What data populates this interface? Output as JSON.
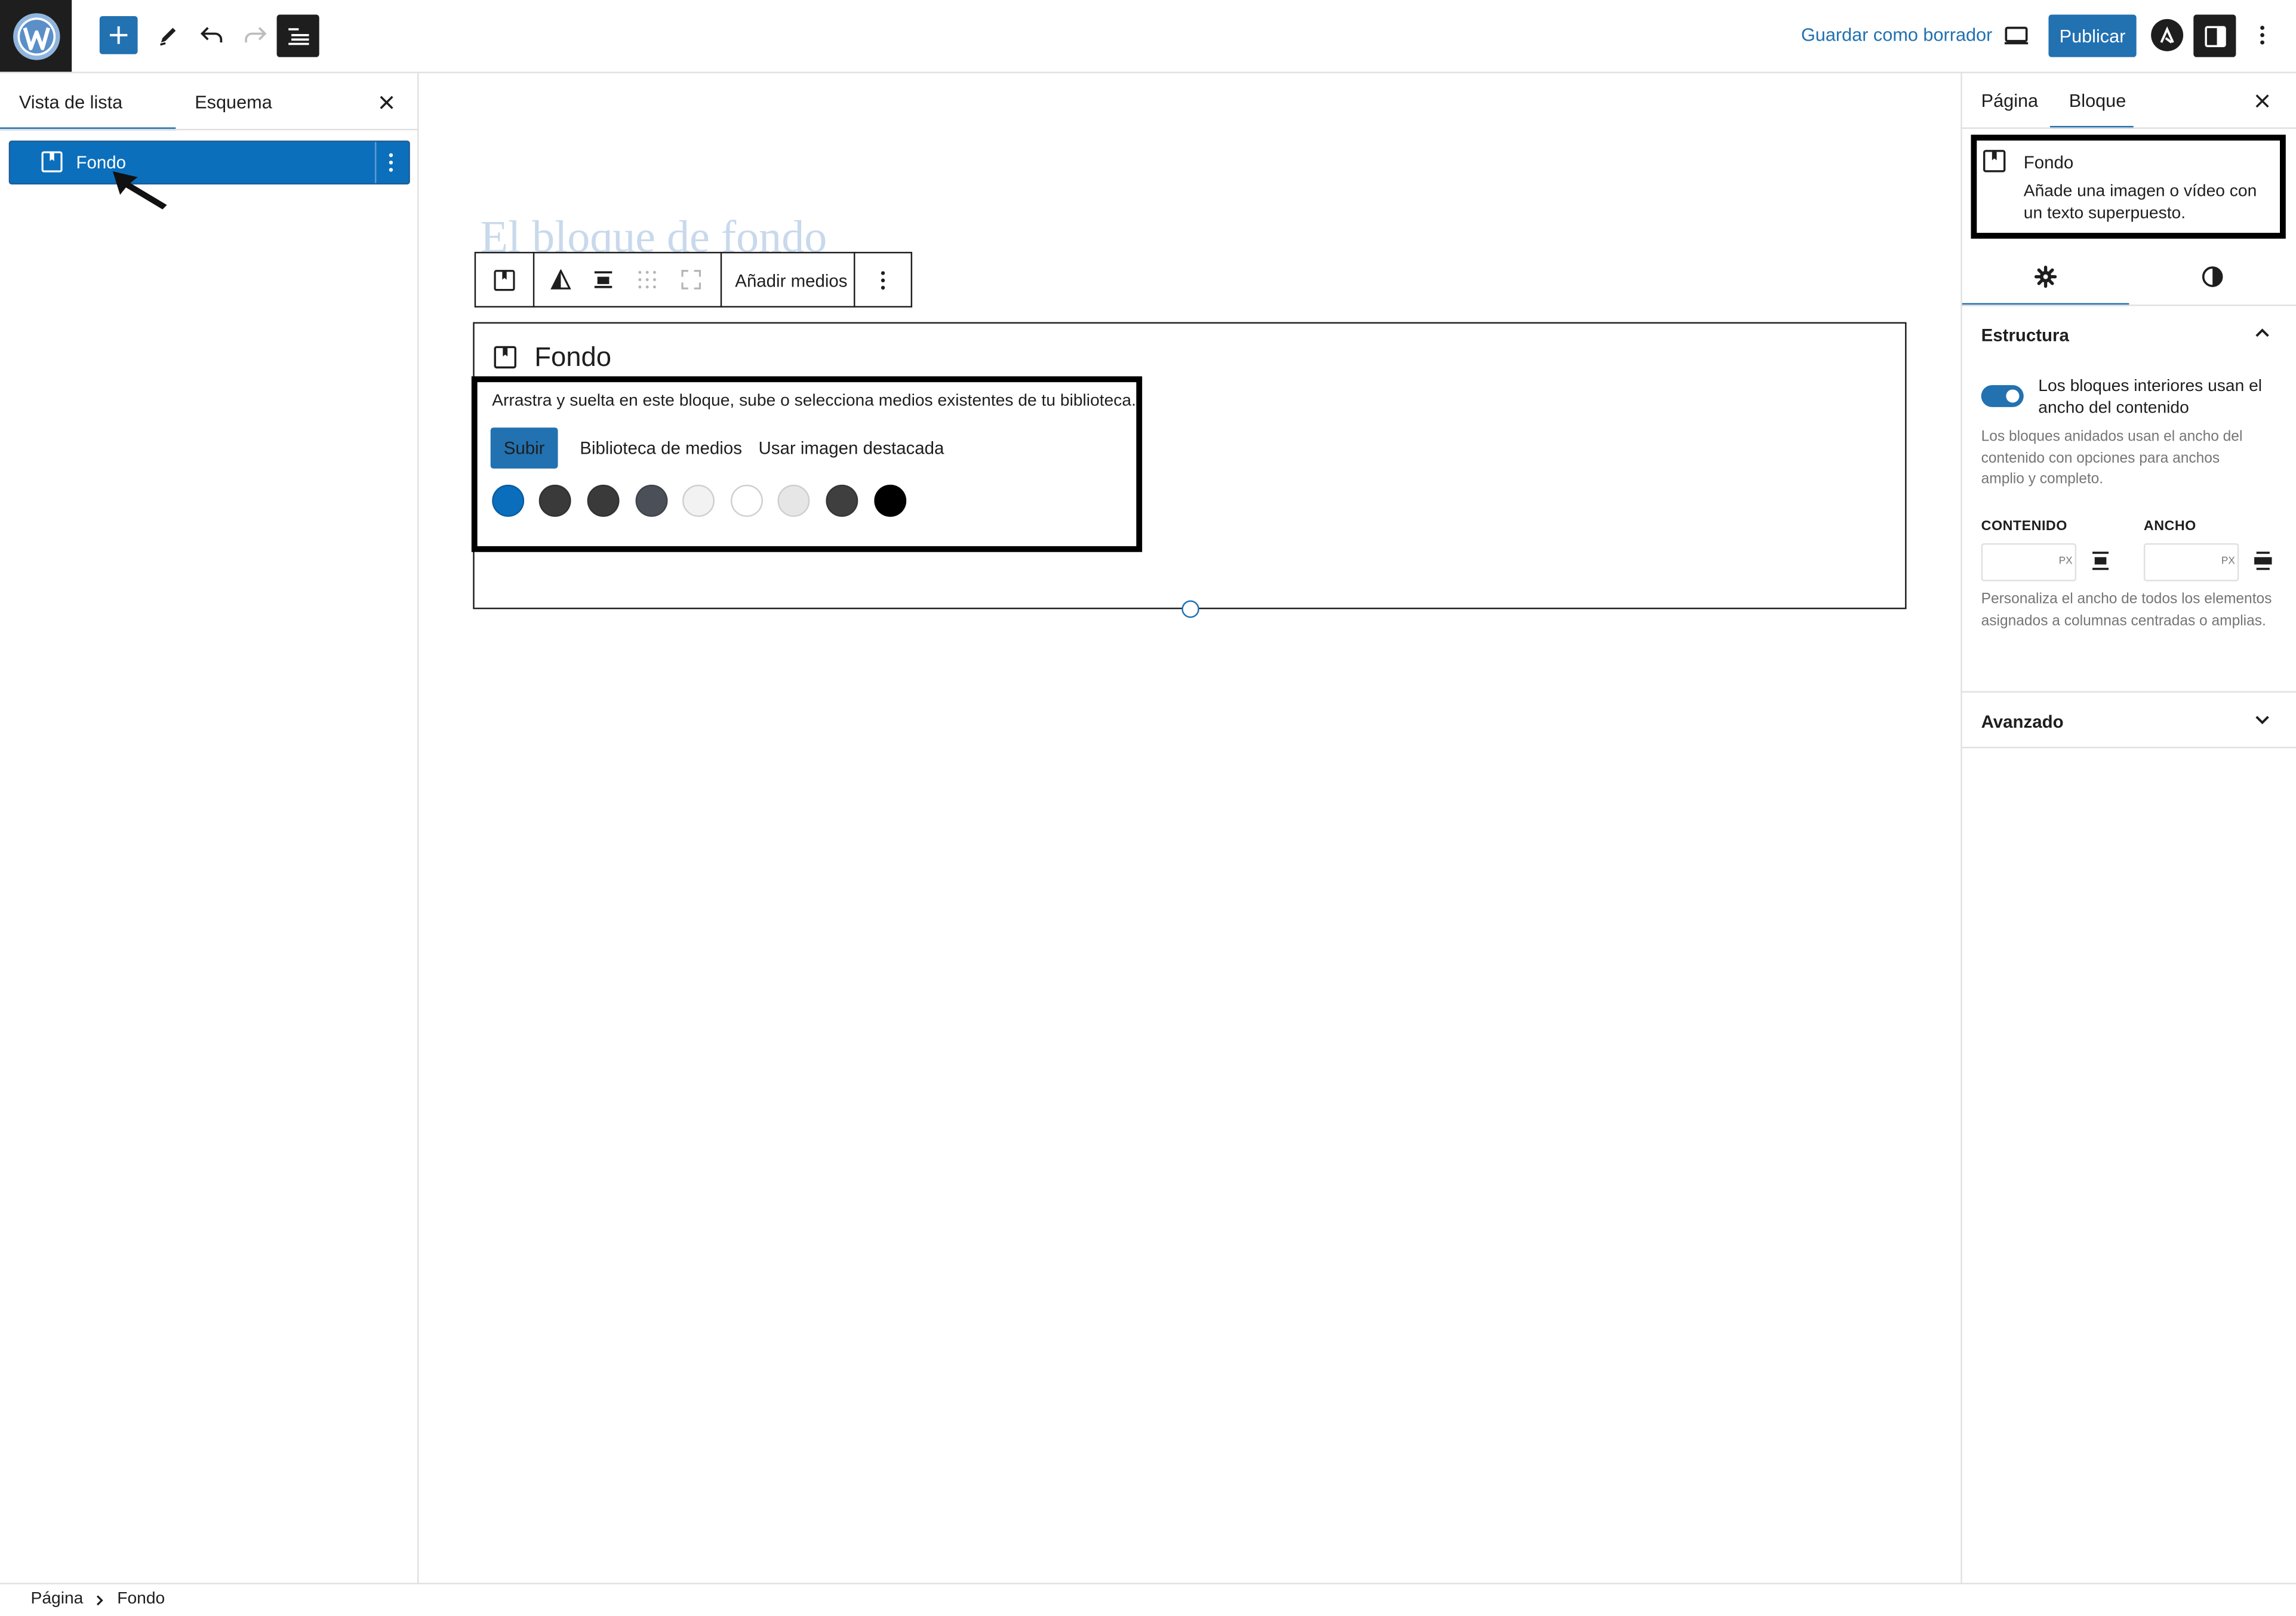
{
  "header": {
    "save_draft": "Guardar como borrador",
    "publish": "Publicar",
    "icons": [
      "wordpress-logo-icon",
      "plus-icon",
      "pencil-icon",
      "undo-icon",
      "redo-icon",
      "document-overview-icon",
      "desktop-preview-icon",
      "astra-icon",
      "sidebar-toggle-icon",
      "more-vertical-icon"
    ]
  },
  "left_panel": {
    "tabs": [
      "Vista de lista",
      "Esquema"
    ],
    "active_tab": "Vista de lista",
    "items": [
      {
        "label": "Fondo",
        "selected": true
      }
    ]
  },
  "canvas": {
    "page_title_placeholder": "El bloque de fondo",
    "block_toolbar": {
      "add_media": "Añadir medios"
    },
    "cover_block": {
      "title": "Fondo",
      "instructions": "Arrastra y suelta en este bloque, sube o selecciona medios existentes de tu biblioteca.",
      "upload": "Subir",
      "media_library": "Biblioteca de medios",
      "featured_image": "Usar imagen destacada",
      "swatches": [
        "#0a6ebd",
        "#3a3a3a",
        "#3a3a3a",
        "#4b4f58",
        "#f2f2f2",
        "#ffffff",
        "#e6e6e6",
        "#3f3f3f",
        "#000000"
      ]
    }
  },
  "right_panel": {
    "tabs": [
      "Página",
      "Bloque"
    ],
    "active_tab": "Bloque",
    "block_card": {
      "title": "Fondo",
      "description": "Añade una imagen o vídeo con un texto superpuesto."
    },
    "structure": {
      "title": "Estructura",
      "toggle_label": "Los bloques interiores usan el ancho del contenido",
      "toggle_on": true,
      "toggle_help": "Los bloques anidados usan el ancho del contenido con opciones para anchos amplio y completo.",
      "content_label": "CONTENIDO",
      "wide_label": "ANCHO",
      "unit": "PX",
      "width_help": "Personaliza el ancho de todos los elementos asignados a columnas centradas o amplias."
    },
    "advanced": {
      "title": "Avanzado"
    }
  },
  "breadcrumb": [
    "Página",
    "Fondo"
  ],
  "colors": {
    "accent": "#2271b1",
    "selected_row": "#0c6fbb"
  }
}
